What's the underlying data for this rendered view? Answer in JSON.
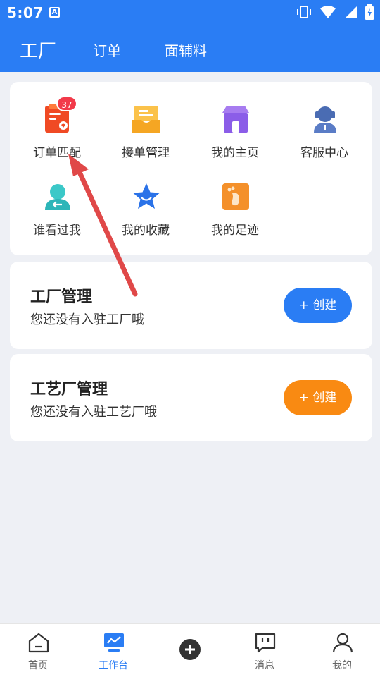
{
  "status_bar": {
    "time": "5:07",
    "a_icon": "A"
  },
  "header": {
    "tabs": [
      {
        "label": "工厂"
      },
      {
        "label": "订单"
      },
      {
        "label": "面辅料"
      }
    ]
  },
  "features": [
    {
      "label": "订单匹配",
      "icon": "order-match-icon",
      "badge": "37"
    },
    {
      "label": "接单管理",
      "icon": "order-accept-icon"
    },
    {
      "label": "我的主页",
      "icon": "shop-home-icon"
    },
    {
      "label": "客服中心",
      "icon": "customer-service-icon"
    },
    {
      "label": "谁看过我",
      "icon": "visitors-icon"
    },
    {
      "label": "我的收藏",
      "icon": "favorites-star-icon"
    },
    {
      "label": "我的足迹",
      "icon": "footprint-icon"
    }
  ],
  "factory_mgmt": {
    "title": "工厂管理",
    "subtitle": "您还没有入驻工厂哦",
    "button": "+ 创建"
  },
  "craft_mgmt": {
    "title": "工艺厂管理",
    "subtitle": "您还没有入驻工艺厂哦",
    "button": "+ 创建"
  },
  "bottom_nav": [
    {
      "label": "首页"
    },
    {
      "label": "工作台"
    },
    {
      "label": ""
    },
    {
      "label": "消息"
    },
    {
      "label": "我的"
    }
  ],
  "colors": {
    "primary": "#2a7df4",
    "orange": "#f98a12",
    "badge_red": "#f23a4a",
    "annotation_arrow": "#e04848"
  }
}
